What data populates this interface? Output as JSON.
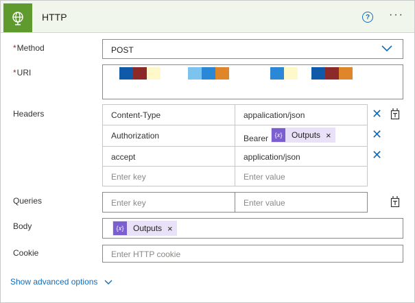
{
  "header": {
    "title": "HTTP",
    "help_label": "?",
    "more_label": "···"
  },
  "method": {
    "label": "Method",
    "required_mark": "*",
    "value": "POST"
  },
  "uri": {
    "label": "URI",
    "required_mark": "*",
    "redaction_colors": [
      "#0f5aa8",
      "#8c2a2a",
      "#fff8c8",
      "#7cc4ee",
      "#2a88d6",
      "#e0862a",
      "#2a88d6",
      "#fff8c8",
      "#0f5aa8",
      "#8c2a2a",
      "#e0862a"
    ]
  },
  "headers": {
    "label": "Headers",
    "rows": [
      {
        "key": "Content-Type",
        "value": "appalication/json"
      },
      {
        "key": "Authorization",
        "value_prefix": "Bearer",
        "value_token": "Outputs"
      },
      {
        "key": "accept",
        "value": "application/json"
      }
    ],
    "key_placeholder": "Enter key",
    "value_placeholder": "Enter value"
  },
  "queries": {
    "label": "Queries",
    "key_placeholder": "Enter key",
    "value_placeholder": "Enter value"
  },
  "body": {
    "label": "Body",
    "token": "Outputs"
  },
  "cookie": {
    "label": "Cookie",
    "placeholder": "Enter HTTP cookie"
  },
  "advanced": {
    "label": "Show advanced options"
  },
  "colors": {
    "accent": "#0f6cbd",
    "header_bg": "#f1f6ec",
    "icon_bg": "#5f9a2e",
    "token_bg": "#e8e1f7",
    "token_icon": "#7b5fcf",
    "required": "#a4262c"
  },
  "icons": {
    "connector": "globe-icon",
    "help": "help-circle-icon",
    "more": "more-icon",
    "dropdown": "chevron-down-icon",
    "remove": "close-icon",
    "switch_mode": "text-mode-icon",
    "expression": "expression-icon"
  }
}
